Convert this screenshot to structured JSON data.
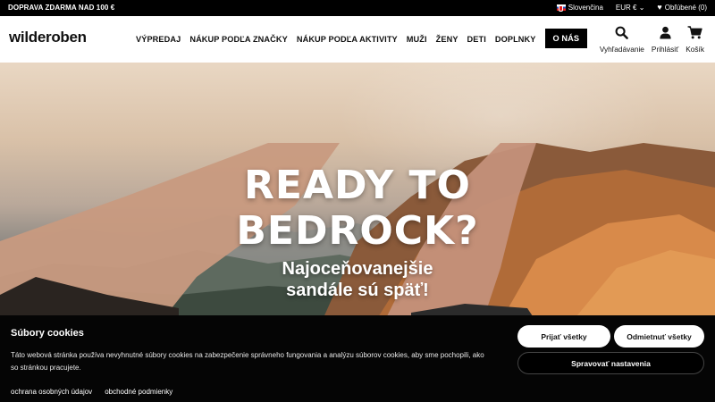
{
  "topbar": {
    "promo": "DOPRAVA ZDARMA NAD 100 €",
    "language": "Slovenčina",
    "currency": "EUR €",
    "favorites": "Obľúbené (0)"
  },
  "header": {
    "logo": "wilderoben",
    "nav": [
      "VÝPREDAJ",
      "NÁKUP PODĽA ZNAČKY",
      "NÁKUP PODĽA AKTIVITY",
      "MUŽI",
      "ŽENY",
      "DETI",
      "DOPLNKY"
    ],
    "about_button": "O NÁS",
    "search_label": "Vyhľadávanie",
    "login_label": "Prihlásiť",
    "cart_label": "Košík"
  },
  "hero": {
    "title_line1": "READY TO",
    "title_line2": "BEDROCK?",
    "subtitle_line1": "Najoceňovanejšie",
    "subtitle_line2": "sandále sú späť!"
  },
  "cookies": {
    "title": "Súbory cookies",
    "description": "Táto webová stránka používa nevyhnutné súbory cookies na zabezpečenie správneho fungovania a analýzu súborov cookies, aby sme pochopili, ako so stránkou pracujete.",
    "accept_label": "Prijať všetky",
    "reject_label": "Odmietnuť všetky",
    "manage_label": "Spravovať nastavenia",
    "privacy_link": "ochrana osobných údajov",
    "terms_link": "obchodné podmienky"
  }
}
